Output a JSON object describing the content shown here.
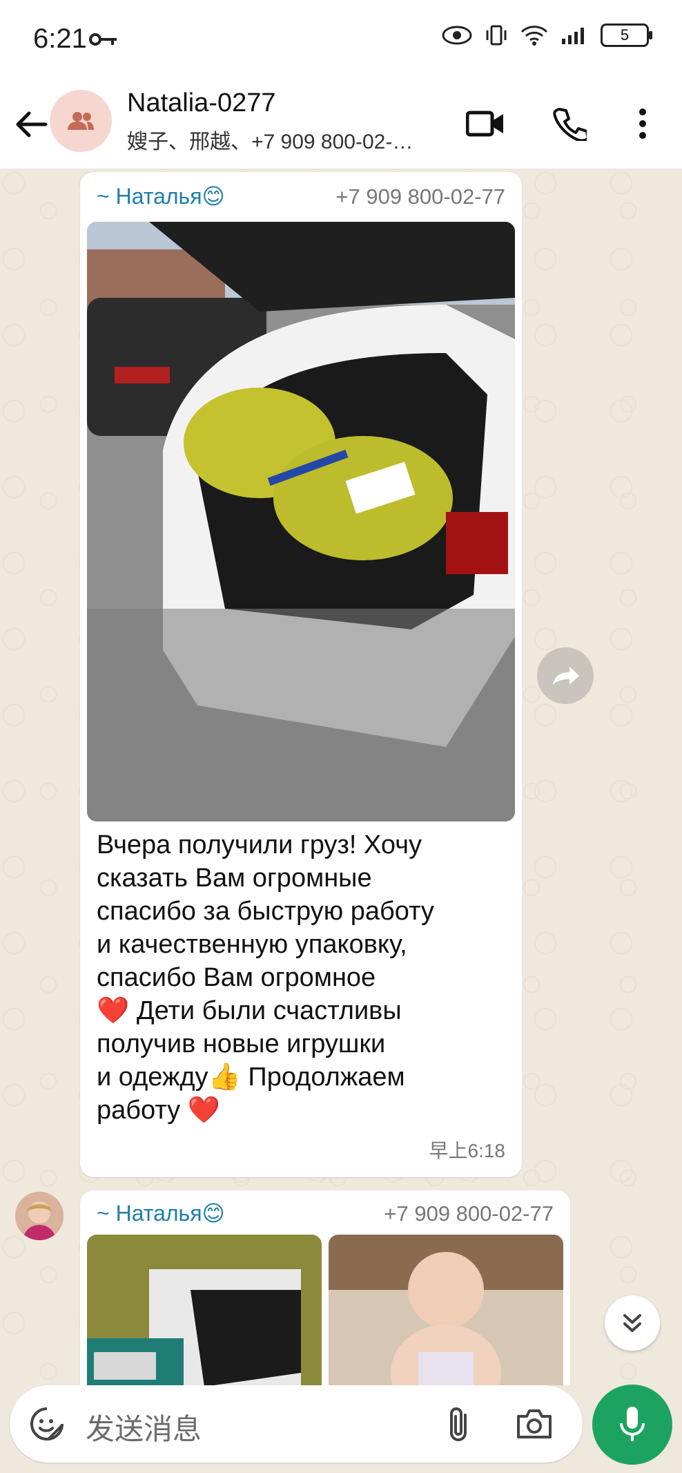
{
  "status_bar": {
    "time": "6:21",
    "battery": "5"
  },
  "header": {
    "title": "Natalia-0277",
    "subtitle": "嫂子、邢越、+7 909 800-02-…"
  },
  "messages": [
    {
      "sender": "~ Наталья😊",
      "phone": "+7 909 800-02-77",
      "text_lines": [
        "Вчера получили груз! Хочу",
        "сказать Вам огромные",
        "спасибо за быструю работу",
        "и качественную упаковку,",
        "спасибо Вам огромное",
        "❤️ Дети были счастливы",
        "получив новые игрушки",
        "и одежду👍 Продолжаем",
        "работу ❤️"
      ],
      "time": "早上6:18"
    },
    {
      "sender": "~ Наталья😊",
      "phone": "+7 909 800-02-77"
    }
  ],
  "composer": {
    "placeholder": "发送消息"
  },
  "colors": {
    "accent": "#1ca35f",
    "sender": "#1e7ea8",
    "chat_bg": "#efe8dc"
  }
}
